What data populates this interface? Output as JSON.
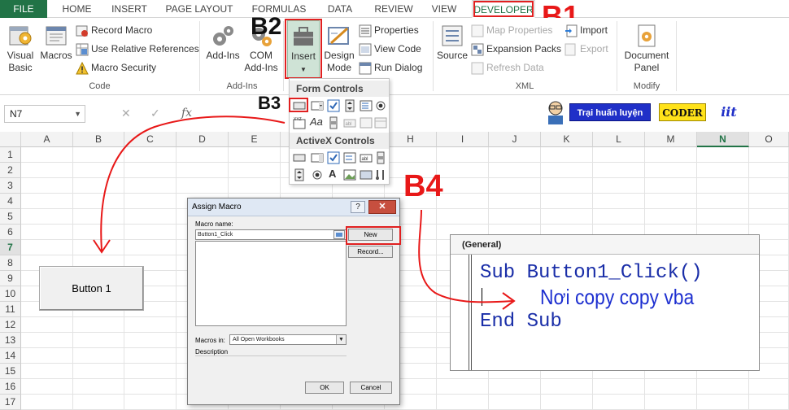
{
  "tabs": [
    "FILE",
    "HOME",
    "INSERT",
    "PAGE LAYOUT",
    "FORMULAS",
    "DATA",
    "REVIEW",
    "VIEW",
    "DEVELOPER"
  ],
  "steps": {
    "b1": "B1",
    "b2": "B2",
    "b3": "B3",
    "b4": "B4"
  },
  "ribbon": {
    "code": {
      "visual_basic": "Visual\nBasic",
      "visual_basic_l1": "Visual",
      "visual_basic_l2": "Basic",
      "macros": "Macros",
      "record_macro": "Record Macro",
      "use_relative": "Use Relative References",
      "macro_security": "Macro Security",
      "group": "Code"
    },
    "addins": {
      "addins": "Add-Ins",
      "com_l1": "COM",
      "com_l2": "Add-Ins",
      "group": "Add-Ins"
    },
    "controls": {
      "insert": "Insert",
      "design_l1": "Design",
      "design_l2": "Mode",
      "properties": "Properties",
      "view_code": "View Code",
      "run_dialog": "Run Dialog"
    },
    "xml": {
      "source": "Source",
      "map_properties": "Map Properties",
      "expansion_packs": "Expansion Packs",
      "refresh_data": "Refresh Data",
      "import": "Import",
      "export": "Export",
      "group": "XML"
    },
    "modify": {
      "doc_l1": "Document",
      "doc_l2": "Panel",
      "group": "Modify"
    }
  },
  "formula_bar": {
    "name_box": "N7",
    "fx": "fx",
    "cancel": "✕",
    "confirm": "✓"
  },
  "logos": {
    "trai": "Trại huấn luyện",
    "coder": "CODER",
    "iit": "iit"
  },
  "columns": [
    "A",
    "B",
    "C",
    "D",
    "E",
    "F",
    "G",
    "H",
    "I",
    "J",
    "K",
    "L",
    "M",
    "N",
    "O"
  ],
  "rows": [
    "1",
    "2",
    "3",
    "4",
    "5",
    "6",
    "7",
    "8",
    "9",
    "10",
    "11",
    "12",
    "13",
    "14",
    "15",
    "16",
    "17"
  ],
  "selected": {
    "column": "N",
    "row": "7"
  },
  "sheet_button": "Button 1",
  "insert_dropdown": {
    "form_controls": "Form Controls",
    "activex_controls": "ActiveX Controls"
  },
  "dialog": {
    "title": "Assign Macro",
    "help": "?",
    "close": "✕",
    "macro_name_label": "Macro name:",
    "macro_name_value": "Button1_Click",
    "new_btn": "New",
    "record_btn": "Record...",
    "macros_in_label": "Macros in:",
    "macros_in_value": "All Open Workbooks",
    "description_label": "Description",
    "ok": "OK",
    "cancel": "Cancel"
  },
  "vba": {
    "header": "(General)",
    "line1": "Sub Button1_Click()",
    "line2": "Nơi copy copy vba",
    "line3": "End Sub"
  },
  "colors": {
    "excel_green": "#217346",
    "annotation_red": "#e81818",
    "code_blue": "#1a2ea8"
  }
}
